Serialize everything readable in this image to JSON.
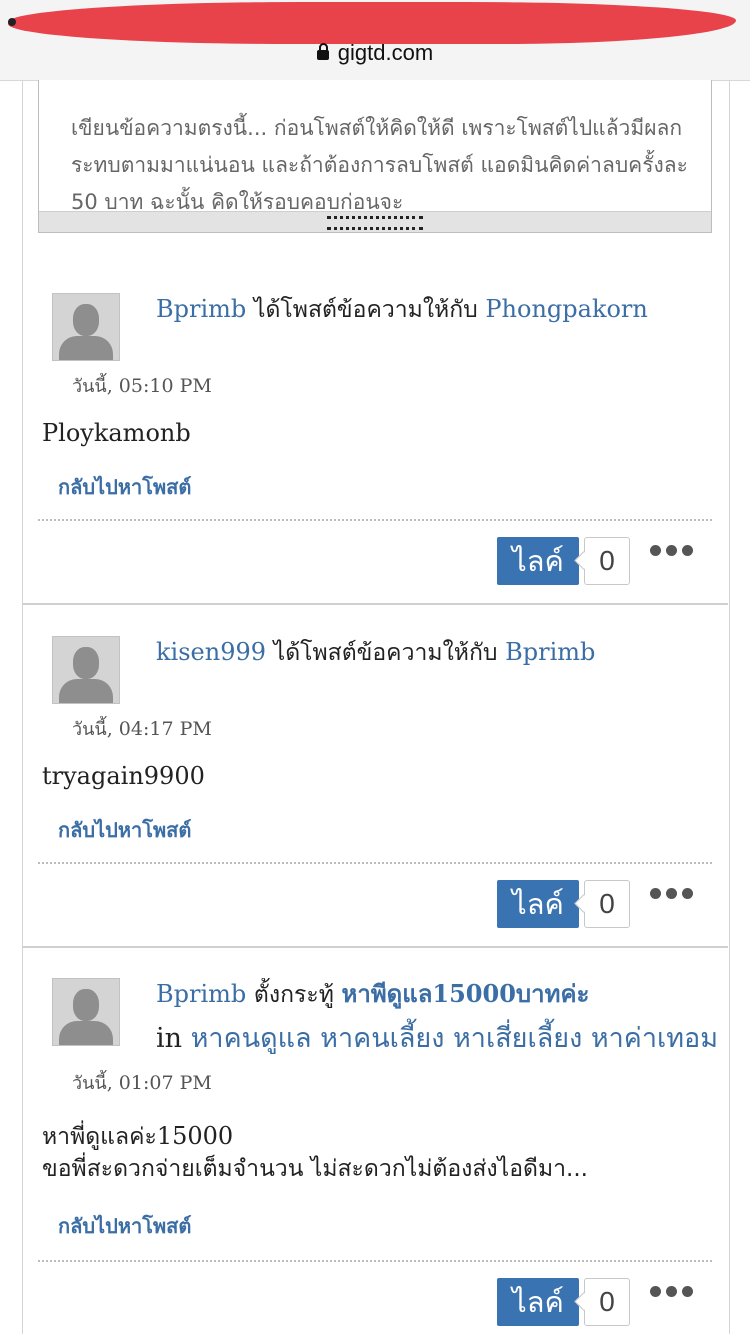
{
  "browser": {
    "url": "gigtd.com"
  },
  "composer": {
    "text": "เขียนข้อความตรงนี้... ก่อนโพสต์ให้คิดให้ดี เพราะโพสต์ไปแล้วมีผลกระทบตามมาแน่นอน และถ้าต้องการลบโพสต์ แอดมินคิดค่าลบครั้งละ 50 บาท ฉะนั้น คิดให้รอบคอบก่อนจะ"
  },
  "posts": [
    {
      "author": "Bprimb",
      "verb": "ได้โพสต์ข้อความให้กับ",
      "target": "Phongpakorn",
      "time_prefix": "วันนี้",
      "time": ", 05:10 PM",
      "body": "Ploykamonb",
      "back_label": "กลับไปหาโพสต์",
      "like_label": "ไลค์",
      "like_count": "0"
    },
    {
      "author": "kisen999",
      "verb": "ได้โพสต์ข้อความให้กับ",
      "target": "Bprimb",
      "time_prefix": "วันนี้",
      "time": ", 04:17 PM",
      "body": "tryagain9900",
      "back_label": "กลับไปหาโพสต์",
      "like_label": "ไลค์",
      "like_count": "0"
    },
    {
      "author": "Bprimb",
      "verb": "ตั้งกระทู้",
      "topic": "หาพีดูแล15000บาทค่ะ",
      "in_label": "in",
      "categories": "หาคนดูแล หาคนเลี้ยง หาเสี่ยเลี้ยง หาค่าเทอม",
      "time_prefix": "วันนี้",
      "time": ", 01:07 PM",
      "body_line1_th": "หาพี่ดูแลค่ะ",
      "body_line1_num": "15000",
      "body_line2": "ขอพี่สะดวกจ่ายเต็มจำนวน ไม่สะดวกไม่ต้องส่งไอดีมา...",
      "back_label": "กลับไปหาโพสต์",
      "like_label": "ไลค์",
      "like_count": "0"
    }
  ]
}
